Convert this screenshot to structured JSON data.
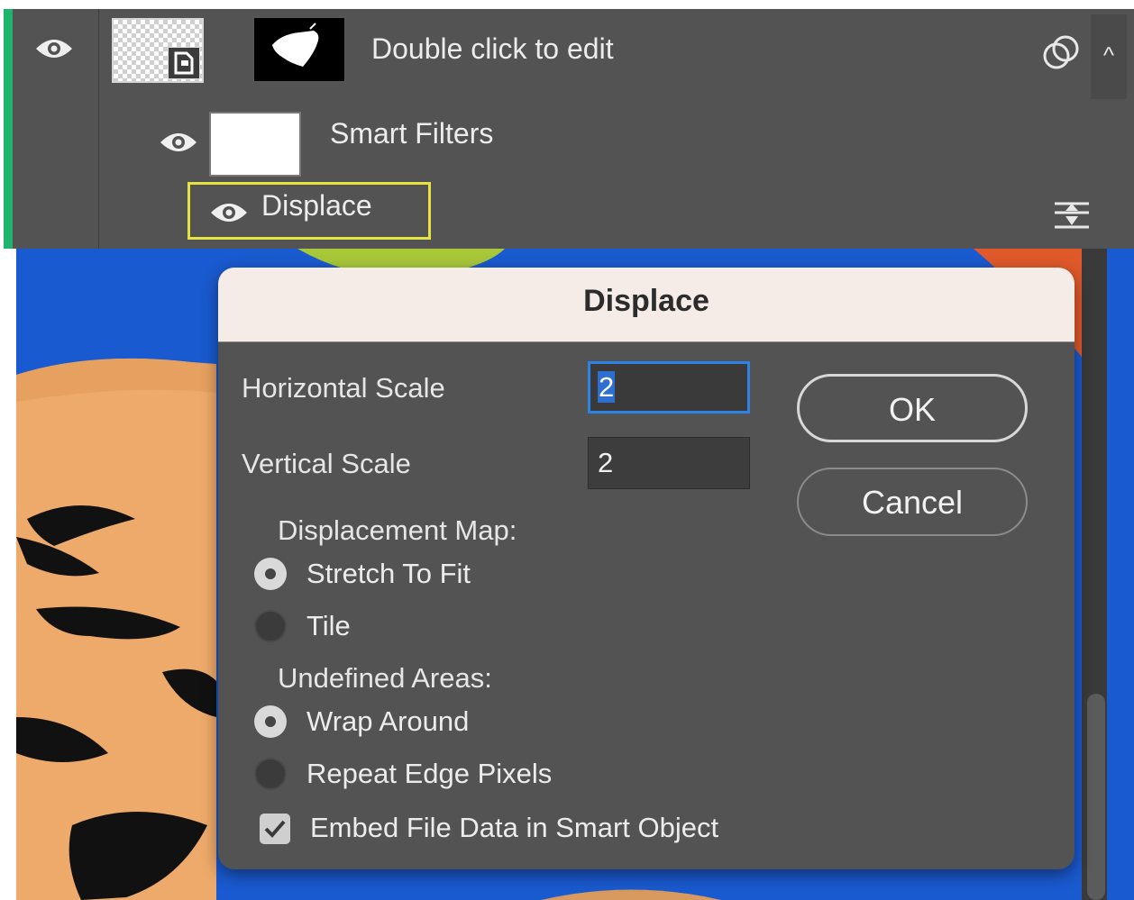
{
  "layers_panel": {
    "layer_name": "Double click to edit",
    "smart_filters_label": "Smart Filters",
    "filter_name": "Displace",
    "collapse_glyph": "^",
    "icons": [
      "eye-icon",
      "smart-object-badge-icon",
      "link-icon",
      "chevron-up-icon",
      "filter-blending-options-icon"
    ],
    "colors": {
      "selected_bar": "#1fb36b",
      "highlight": "#e5e244",
      "panel_bg": "#535353"
    }
  },
  "dialog": {
    "title": "Displace",
    "horizontal_scale": {
      "label": "Horizontal Scale",
      "value": "2"
    },
    "vertical_scale": {
      "label": "Vertical Scale",
      "value": "2"
    },
    "ok_label": "OK",
    "cancel_label": "Cancel",
    "displacement_map": {
      "label": "Displacement Map:",
      "options": [
        {
          "label": "Stretch To Fit",
          "selected": true
        },
        {
          "label": "Tile",
          "selected": false
        }
      ]
    },
    "undefined_areas": {
      "label": "Undefined Areas:",
      "options": [
        {
          "label": "Wrap Around",
          "selected": true
        },
        {
          "label": "Repeat Edge Pixels",
          "selected": false
        }
      ]
    },
    "embed_checkbox": {
      "label": "Embed File Data in Smart Object",
      "checked": true
    }
  }
}
